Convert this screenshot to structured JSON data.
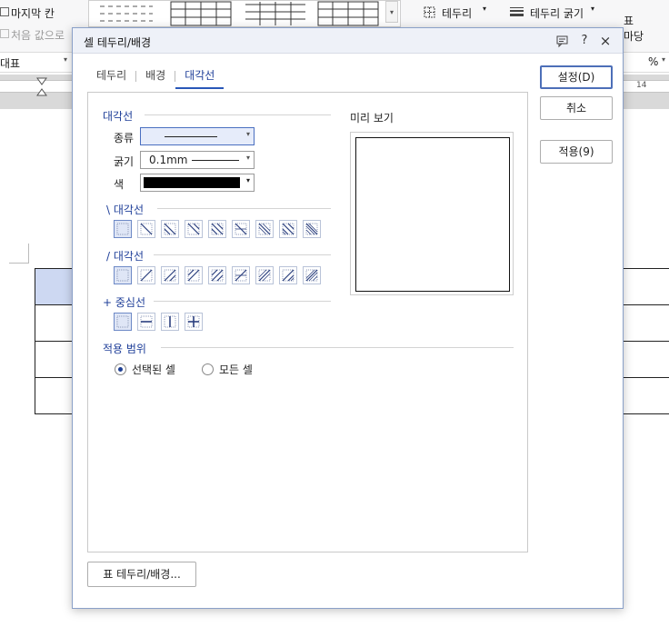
{
  "background": {
    "ribbon": {
      "last_column": "마지막 칸",
      "reset": "처음 값으로",
      "border": "테두리",
      "border_width": "테두리 굵기",
      "table_label_1": "표",
      "table_label_2": "마당"
    },
    "toolbar2": {
      "style_name": "대표",
      "percent": "%"
    },
    "ruler": {
      "tick_14": "14"
    }
  },
  "dialog": {
    "title": "셀 테두리/배경",
    "help": "?",
    "close": "×",
    "tabs": [
      "테두리",
      "배경",
      "대각선"
    ],
    "active_tab": 2,
    "diagonal_group": "대각선",
    "type_label": "종류",
    "width_label": "굵기",
    "width_value": "0.1mm",
    "color_label": "색",
    "color_value": "#000000",
    "backslash_group": "\\ 대각선",
    "slash_group": "/ 대각선",
    "center_group": "+ 중심선",
    "scope_group": "적용 범위",
    "scope_options": [
      "선택된 셀",
      "모든 셀"
    ],
    "scope_selected": 0,
    "preview_label": "미리 보기",
    "buttons": {
      "ok": "설정(D)",
      "cancel": "취소",
      "apply": "적용(9)",
      "table_border": "표 테두리/배경..."
    }
  }
}
